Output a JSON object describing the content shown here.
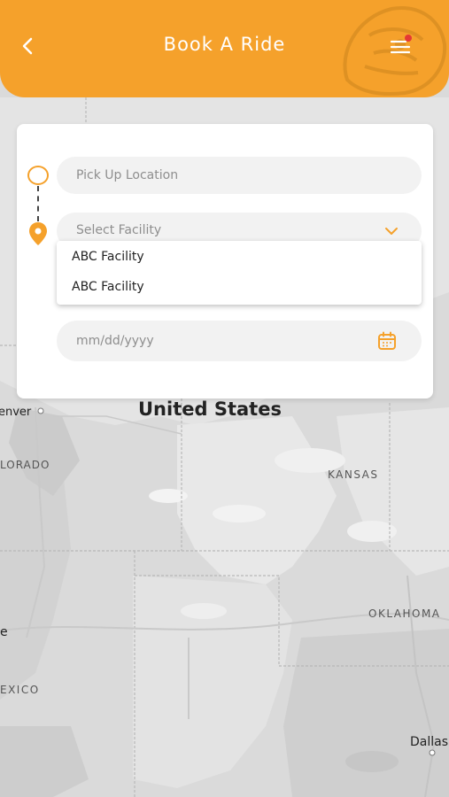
{
  "header": {
    "title": "Book A Ride",
    "back_icon": "chevron-left-icon",
    "menu_icon": "menu-icon",
    "accent_color": "#f5a12b",
    "notification_color": "#e53935"
  },
  "form": {
    "pickup_placeholder": "Pick Up Location",
    "facility_placeholder": "Select Facility",
    "date_placeholder": "mm/dd/yyyy"
  },
  "dropdown": {
    "options": [
      "ABC Facility",
      "ABC Facility"
    ]
  },
  "map": {
    "labels": {
      "country": "United States",
      "denver": "enver",
      "colorado": "LORADO",
      "kansas": "KANSAS",
      "oklahoma": "OKLAHOMA",
      "mexico": "EXICO",
      "e": "e",
      "dallas": "Dallas"
    }
  }
}
